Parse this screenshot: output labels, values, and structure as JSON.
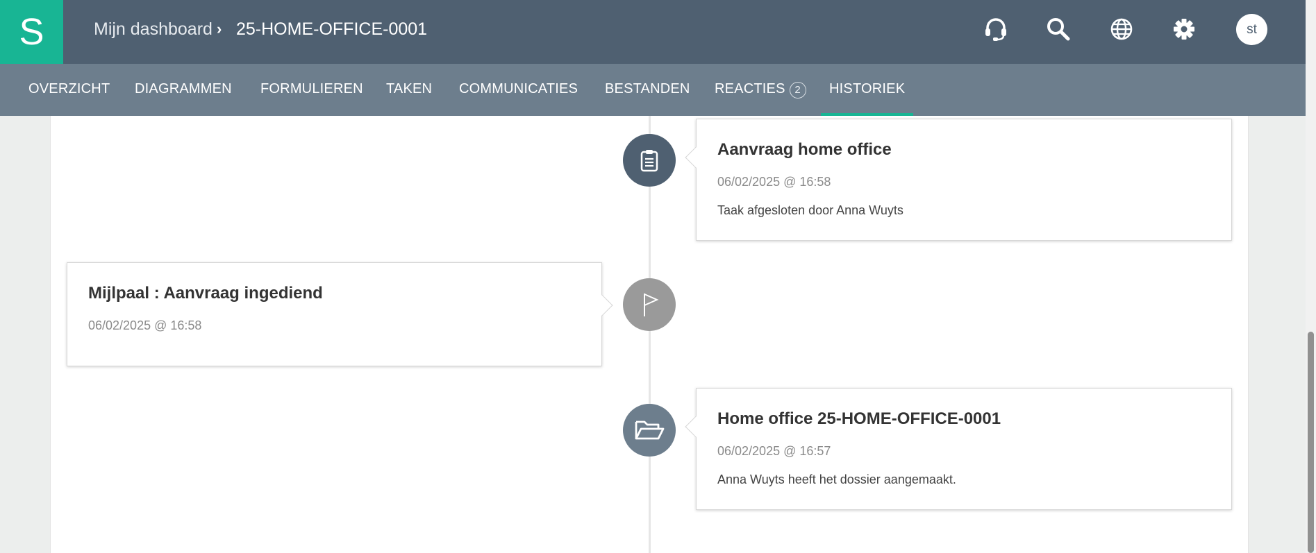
{
  "header": {
    "logo_letter": "S",
    "breadcrumb_home": "Mijn dashboard",
    "breadcrumb_separator": "›",
    "breadcrumb_current": "25-HOME-OFFICE-0001",
    "icons": [
      "headset-icon",
      "search-icon",
      "globe-icon",
      "gear-icon"
    ],
    "avatar_initials": "st"
  },
  "tabs": [
    {
      "label": "OVERZICHT"
    },
    {
      "label": "DIAGRAMMEN"
    },
    {
      "label": "FORMULIEREN"
    },
    {
      "label": "TAKEN"
    },
    {
      "label": "COMMUNICATIES"
    },
    {
      "label": "BESTANDEN"
    },
    {
      "label": "REACTIES",
      "badge": "2"
    },
    {
      "label": "HISTORIEK",
      "active": true
    }
  ],
  "timeline": [
    {
      "title": "Aanvraag home office",
      "time": "06/02/2025 @ 16:58",
      "description": "Taak afgesloten door Anna Wuyts",
      "icon": "clipboard-icon",
      "icon_color": "#4f6071",
      "side": "right"
    },
    {
      "title": "Mijlpaal : Aanvraag ingediend",
      "time": "06/02/2025 @ 16:58",
      "icon": "flag-icon",
      "icon_color": "#9a9a9a",
      "side": "left"
    },
    {
      "title": "Home office 25-HOME-OFFICE-0001",
      "time": "06/02/2025 @ 16:57",
      "description": "Anna Wuyts heeft het dossier aangemaakt.",
      "icon": "folder-open-icon",
      "icon_color": "#6d7e8d",
      "side": "right"
    }
  ],
  "colors": {
    "brand": "#18b594",
    "header": "#4f6071",
    "tabbar": "#6d7e8d"
  }
}
